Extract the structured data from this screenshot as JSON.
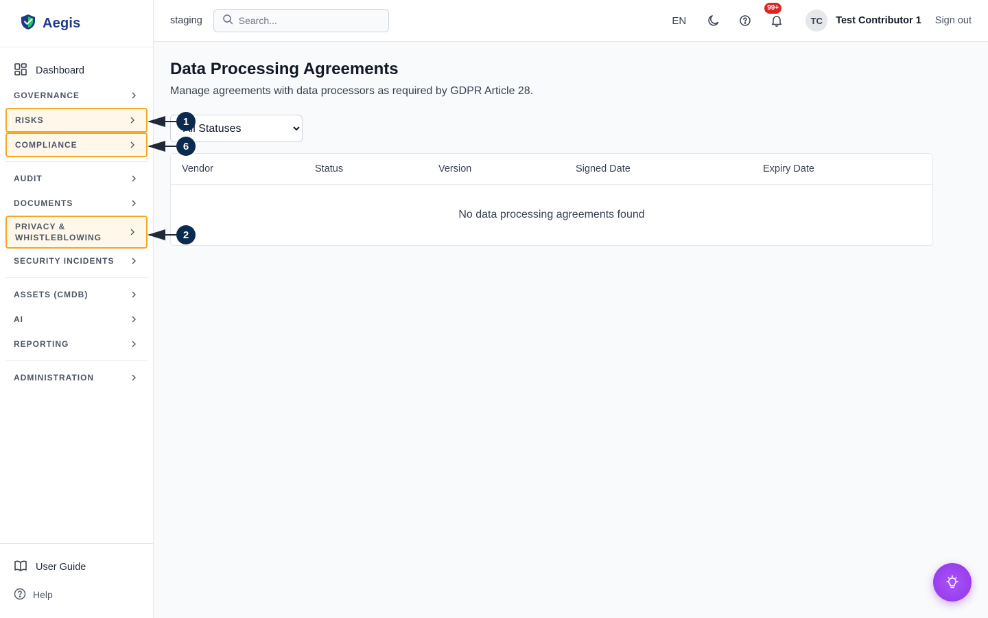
{
  "brand": {
    "name": "Aegis"
  },
  "sidebar": {
    "dashboard": "Dashboard",
    "sections": [
      {
        "label": "GOVERNANCE"
      },
      {
        "label": "RISKS"
      },
      {
        "label": "COMPLIANCE"
      },
      {
        "label": "AUDIT"
      },
      {
        "label": "DOCUMENTS"
      },
      {
        "label": "PRIVACY & WHISTLEBLOWING"
      },
      {
        "label": "SECURITY INCIDENTS"
      },
      {
        "label": "ASSETS (CMDB)"
      },
      {
        "label": "AI"
      },
      {
        "label": "REPORTING"
      },
      {
        "label": "ADMINISTRATION"
      }
    ],
    "user_guide": "User Guide",
    "help": "Help"
  },
  "topbar": {
    "env": "staging",
    "search_placeholder": "Search...",
    "lang": "EN",
    "notifications_badge": "99+",
    "avatar_initials": "TC",
    "user_name": "Test Contributor 1",
    "sign_out": "Sign out"
  },
  "main": {
    "title": "Data Processing Agreements",
    "subtitle": "Manage agreements with data processors as required by GDPR Article 28.",
    "filter_selected": "All Statuses",
    "columns": [
      "Vendor",
      "Status",
      "Version",
      "Signed Date",
      "Expiry Date"
    ],
    "empty_message": "No data processing agreements found"
  },
  "annotations": [
    {
      "number": "1"
    },
    {
      "number": "6"
    },
    {
      "number": "2"
    }
  ],
  "colors": {
    "highlight": "#f5a623",
    "marker": "#0b2a4f",
    "fab": "#9333ea",
    "badge": "#dc2626"
  }
}
